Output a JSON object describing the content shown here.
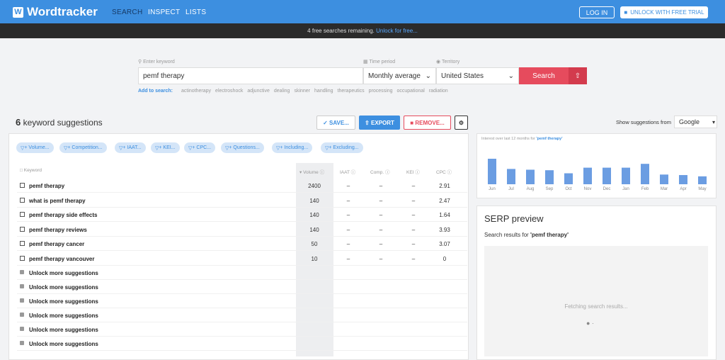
{
  "brand": "Wordtracker",
  "nav": {
    "search": "SEARCH",
    "inspect": "INSPECT",
    "lists": "LISTS"
  },
  "header": {
    "login": "LOG IN",
    "unlock": "UNLOCK WITH FREE TRIAL"
  },
  "banner": {
    "text": "4 free searches remaining.",
    "link": "Unlock for free..."
  },
  "search": {
    "keyword_label": "Enter keyword",
    "keyword": "pemf therapy",
    "period_label": "Time period",
    "period": "Monthly average",
    "territory_label": "Territory",
    "territory": "United States",
    "button": "Search"
  },
  "add_to_search": {
    "label": "Add to search:",
    "terms": [
      "actinotherapy",
      "electroshock",
      "adjunctive",
      "dealing",
      "skinner",
      "handling",
      "therapeutics",
      "processing",
      "occupational",
      "radiation"
    ]
  },
  "results": {
    "count": "6",
    "title": "keyword suggestions",
    "save": "SAVE...",
    "export": "EXPORT",
    "remove": "REMOVE..."
  },
  "filters": [
    "+ Volume...",
    "+ Competition...",
    "+ IAAT...",
    "+ KEI...",
    "+ CPC...",
    "+ Questions...",
    "+ Including...",
    "+ Excluding..."
  ],
  "table": {
    "headers": {
      "keyword": "Keyword",
      "volume": "Volume",
      "iaat": "IAAT",
      "comp": "Comp.",
      "kei": "KEI",
      "cpc": "CPC"
    },
    "rows": [
      {
        "keyword": "pemf therapy",
        "volume": "2400",
        "iaat": "–",
        "comp": "–",
        "kei": "–",
        "cpc": "2.91"
      },
      {
        "keyword": "what is pemf therapy",
        "volume": "140",
        "iaat": "–",
        "comp": "–",
        "kei": "–",
        "cpc": "2.47"
      },
      {
        "keyword": "pemf therapy side effects",
        "volume": "140",
        "iaat": "–",
        "comp": "–",
        "kei": "–",
        "cpc": "1.64"
      },
      {
        "keyword": "pemf therapy reviews",
        "volume": "140",
        "iaat": "–",
        "comp": "–",
        "kei": "–",
        "cpc": "3.93"
      },
      {
        "keyword": "pemf therapy cancer",
        "volume": "50",
        "iaat": "–",
        "comp": "–",
        "kei": "–",
        "cpc": "3.07"
      },
      {
        "keyword": "pemf therapy vancouver",
        "volume": "10",
        "iaat": "–",
        "comp": "–",
        "kei": "–",
        "cpc": "0"
      }
    ],
    "locked_label": "Unlock more suggestions"
  },
  "suggestions": {
    "label": "Show suggestions from",
    "source": "Google"
  },
  "interest": {
    "prefix": "Interest over last 12 months for",
    "keyword": "'pemf therapy'"
  },
  "chart_data": {
    "type": "bar",
    "categories": [
      "Jun",
      "Jul",
      "Aug",
      "Sep",
      "Oct",
      "Nov",
      "Dec",
      "Jan",
      "Feb",
      "Mar",
      "Apr",
      "May"
    ],
    "values": [
      1.0,
      0.6,
      0.57,
      0.55,
      0.43,
      0.65,
      0.65,
      0.65,
      0.8,
      0.38,
      0.36,
      0.31
    ],
    "title": "",
    "xlabel": "",
    "ylabel": ""
  },
  "serp": {
    "title": "SERP preview",
    "subtitle": "Search results for",
    "keyword": "'pemf therapy'",
    "status": "Fetching search results..."
  }
}
